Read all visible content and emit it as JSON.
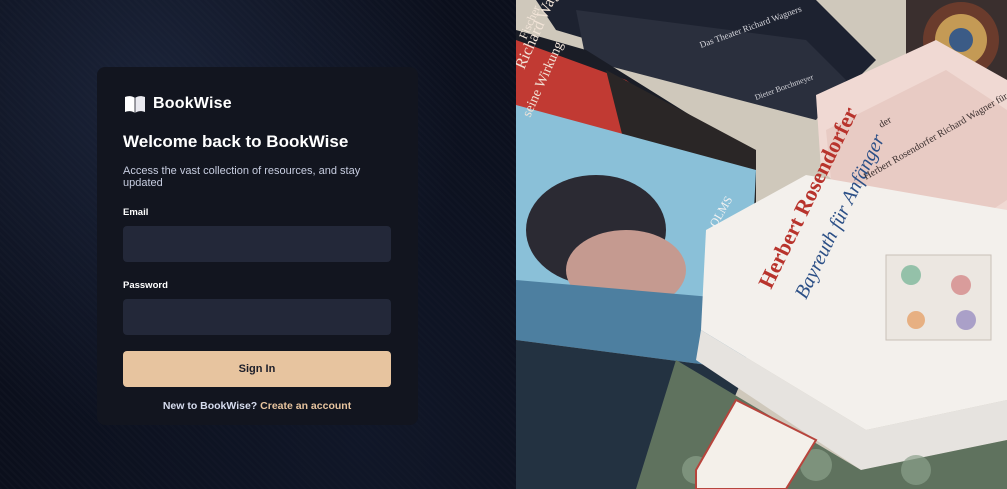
{
  "brand": {
    "name": "BookWise",
    "logo_icon": "open-book-icon"
  },
  "login": {
    "title": "Welcome back to BookWise",
    "subtitle": "Access the vast collection of resources, and stay updated",
    "email_label": "Email",
    "email_value": "",
    "password_label": "Password",
    "password_value": "",
    "submit_label": "Sign In",
    "footer_prompt": "New to BookWise?",
    "footer_link": "Create an account"
  },
  "hero_image": {
    "description_text": {
      "book_author": "Herbert Rosendorfer",
      "book_title": "Bayreuth für Anfänger",
      "spine_olms": "OLMS",
      "spine_wagner": "Richard Wagner",
      "spine_wirkung": "seine Wirkung",
      "spine_fischer": "Fischer",
      "spine_theater": "Das Theater Richard Wagners",
      "spine_dieter": "Dieter Borchmeyer",
      "spine_rosendorfer_side": "Herbert Rosendorfer Richard Wagner für Fortgeschrittene",
      "spine_der": "der"
    }
  },
  "colors": {
    "accent": "#e7c49f",
    "card_bg": "#12151f",
    "input_bg": "#232839",
    "page_bg": "#0b0f1c"
  }
}
